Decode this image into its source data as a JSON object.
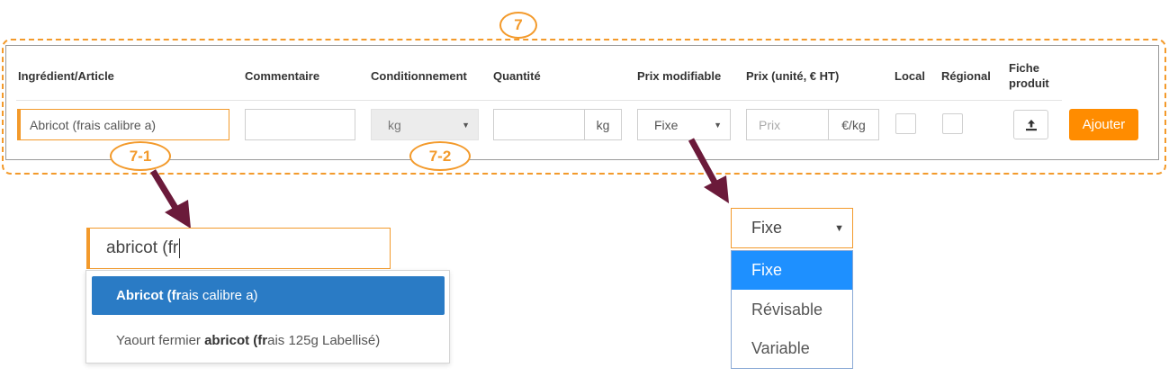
{
  "annotations": {
    "main": "7",
    "search_field": "7-1",
    "packaging_field": "7-2"
  },
  "table": {
    "headers": {
      "ingredient": "Ingrédient/Article",
      "comment": "Commentaire",
      "packaging": "Conditionnement",
      "quantity": "Quantité",
      "price_editable": "Prix modifiable",
      "price": "Prix (unité, € HT)",
      "local": "Local",
      "regional": "Régional",
      "product_sheet": "Fiche produit"
    },
    "row": {
      "ingredient_value": "Abricot (frais calibre a)",
      "comment_value": "",
      "packaging_value": "kg",
      "quantity_value": "",
      "quantity_unit": "kg",
      "price_mode_value": "Fixe",
      "price_placeholder": "Prix",
      "price_unit": "€/kg",
      "local_checked": false,
      "regional_checked": false,
      "upload_icon": "upload-icon",
      "add_label": "Ajouter"
    }
  },
  "search_zoom": {
    "typed_text": "abricot (fr",
    "suggestions": [
      {
        "prefix": "",
        "bold": "Abricot (fr",
        "suffix": "ais calibre a)",
        "highlighted": true
      },
      {
        "prefix": "Yaourt fermier ",
        "bold": "abricot (fr",
        "suffix": "ais 125g Labellisé)",
        "highlighted": false
      }
    ]
  },
  "select_zoom": {
    "value": "Fixe",
    "options": [
      "Fixe",
      "Révisable",
      "Variable"
    ],
    "selected_index": 0
  },
  "colors": {
    "accent_orange": "#f39a2b",
    "button_orange": "#ff8c00",
    "highlight_blue": "#2a7bc5",
    "option_blue": "#1e90ff",
    "arrow": "#6b1a3a"
  }
}
